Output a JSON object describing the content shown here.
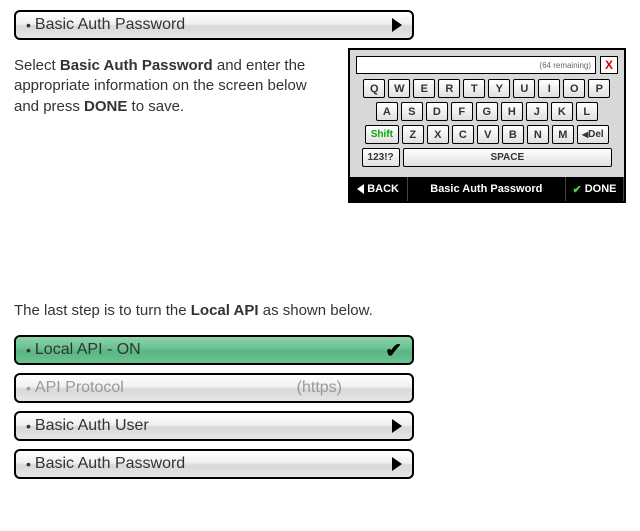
{
  "top_button": {
    "label": "Basic Auth Password"
  },
  "instruction1": {
    "pre": "Select ",
    "b1": "Basic Auth Password",
    "mid": " and enter the appropriate information on the screen below and press ",
    "b2": "DONE",
    "post": " to save."
  },
  "keyboard": {
    "remaining": "(64 remaining)",
    "row1": [
      "Q",
      "W",
      "E",
      "R",
      "T",
      "Y",
      "U",
      "I",
      "O",
      "P"
    ],
    "row2": [
      "A",
      "S",
      "D",
      "F",
      "G",
      "H",
      "J",
      "K",
      "L"
    ],
    "shift": "Shift",
    "row3": [
      "Z",
      "X",
      "C",
      "V",
      "B",
      "N",
      "M"
    ],
    "del": "Del",
    "num": "123!?",
    "space": "SPACE",
    "back": "BACK",
    "title": "Basic Auth Password",
    "done": "DONE"
  },
  "instruction2": {
    "pre": "The last step is to turn the ",
    "b1": "Local API",
    "post": " as shown below."
  },
  "menu": {
    "local_api": "Local API  -  ON",
    "api_protocol": "API Protocol",
    "api_protocol_hint": "(https)",
    "basic_auth_user": "Basic Auth User",
    "basic_auth_password": "Basic Auth Password"
  }
}
